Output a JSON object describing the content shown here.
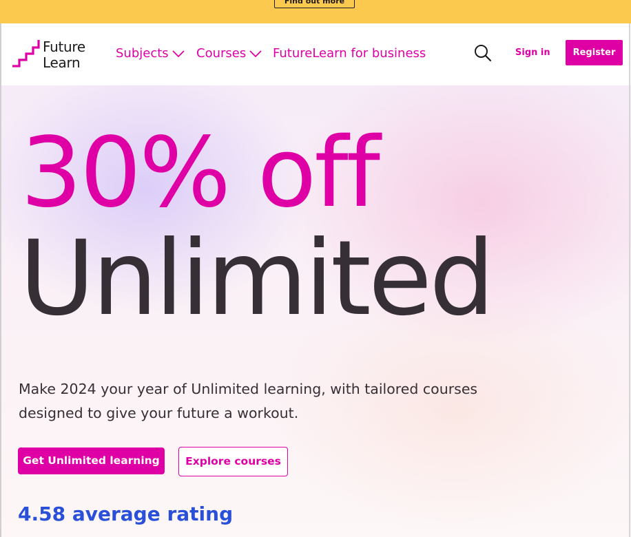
{
  "banner": {
    "button_label": "Find out more",
    "background": "#fbc94e"
  },
  "header": {
    "logo": {
      "line1": "Future",
      "line2": "Learn"
    },
    "nav": {
      "subjects": "Subjects",
      "courses": "Courses",
      "business": "FutureLearn for business"
    },
    "icons": {
      "search": "search-icon",
      "chevron": "chevron-down-icon"
    },
    "sign_in": "Sign in",
    "register": "Register"
  },
  "hero": {
    "headline_offer": "30% off",
    "headline_product": "Unlimited",
    "description": "Make 2024 your year of Unlimited learning, with tailored courses designed to give your future a workout.",
    "primary_cta": "Get Unlimited learning",
    "secondary_cta": "Explore courses",
    "rating": "4.58 average rating"
  },
  "colors": {
    "brand": "#de00a5",
    "text_dark": "#362f35",
    "rating_blue": "#2a4fd8",
    "banner_yellow": "#fbc94e"
  }
}
